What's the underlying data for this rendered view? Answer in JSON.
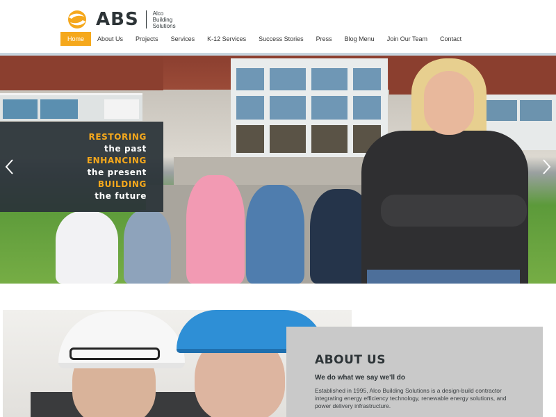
{
  "brand": {
    "abbr": "ABS",
    "sub_lines": [
      "Alco",
      "Building",
      "Solutions"
    ],
    "accent_color": "#f5a81c",
    "dark_color": "#2d3437"
  },
  "nav": {
    "items": [
      {
        "label": "Home",
        "active": true
      },
      {
        "label": "About Us"
      },
      {
        "label": "Projects"
      },
      {
        "label": "Services"
      },
      {
        "label": "K-12 Services"
      },
      {
        "label": "Success Stories"
      },
      {
        "label": "Press"
      },
      {
        "label": "Blog Menu"
      },
      {
        "label": "Join Our Team"
      },
      {
        "label": "Contact"
      }
    ]
  },
  "hero": {
    "tagline": [
      {
        "text": "RESTORING",
        "style": "accent"
      },
      {
        "text": "the past",
        "style": "plain"
      },
      {
        "text": "ENHANCING",
        "style": "accent"
      },
      {
        "text": "the present",
        "style": "plain"
      },
      {
        "text": "BUILDING",
        "style": "accent"
      },
      {
        "text": "the future",
        "style": "plain"
      }
    ],
    "prev_icon": "chevron-left-icon",
    "next_icon": "chevron-right-icon"
  },
  "about": {
    "title": "ABOUT US",
    "subtitle": "We do what we say we'll do",
    "body": "Established in 1995, Alco Building Solutions is a design-build contractor integrating energy efficiency technology, renewable energy solutions, and power delivery infrastructure."
  }
}
